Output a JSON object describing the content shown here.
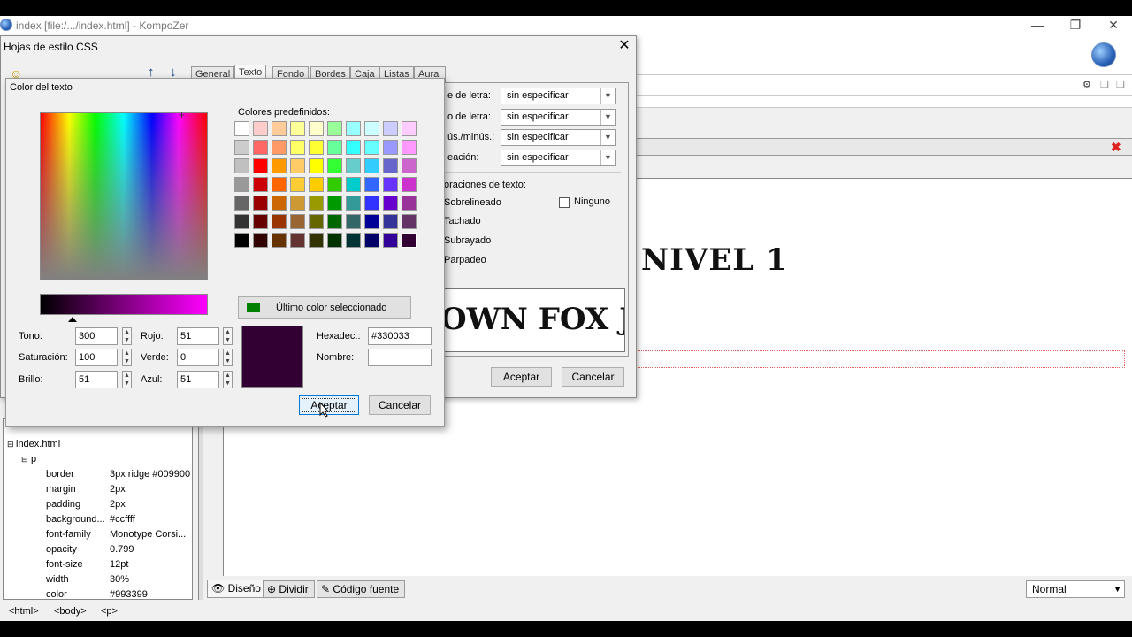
{
  "window": {
    "title": "index [file:/.../index.html] - KompoZer",
    "min": "—",
    "max": "❐",
    "close": "✕"
  },
  "editor": {
    "heading": "NIVEL 1"
  },
  "viewtabs": {
    "design": "Diseño",
    "split": "Dividir",
    "source": "Código fuente",
    "paragraph_format": "Normal"
  },
  "statusbar": {
    "crumbs": [
      "<html>",
      "<body>",
      "<p>"
    ]
  },
  "tree": {
    "root": "index.html",
    "node": "p",
    "props": [
      {
        "name": "border",
        "value": "3px ridge #009900"
      },
      {
        "name": "margin",
        "value": "2px"
      },
      {
        "name": "padding",
        "value": "2px"
      },
      {
        "name": "background...",
        "value": "#ccffff"
      },
      {
        "name": "font-family",
        "value": "Monotype Corsi..."
      },
      {
        "name": "opacity",
        "value": "0.799"
      },
      {
        "name": "font-size",
        "value": "12pt"
      },
      {
        "name": "width",
        "value": "30%"
      },
      {
        "name": "color",
        "value": "#993399"
      }
    ]
  },
  "css_dialog": {
    "title": "Hojas de estilo CSS",
    "close": "✕",
    "tabs": [
      "General",
      "Texto",
      "Fondo",
      "Bordes",
      "Caja",
      "Listas",
      "Aural"
    ],
    "active_tab": "Texto",
    "rows": [
      {
        "label": "e de letra:",
        "value": "sin especificar"
      },
      {
        "label": "o de letra:",
        "value": "sin especificar"
      },
      {
        "label": "ús./minús.:",
        "value": "sin especificar"
      },
      {
        "label": "eación:",
        "value": "sin especificar"
      }
    ],
    "decorations_label": "oraciones de texto:",
    "decorations": [
      "Sobrelineado",
      "Tachado",
      "Subrayado",
      "Parpadeo"
    ],
    "none_label": "Ninguno",
    "preview_text": "OWN FOX JU",
    "accept": "Aceptar",
    "cancel": "Cancelar"
  },
  "color_dialog": {
    "title": "Color del texto",
    "predefined_label": "Colores predefinidos:",
    "swatch_rows": [
      [
        "#ffffff",
        "#ffcccc",
        "#ffcc99",
        "#ffff99",
        "#ffffcc",
        "#99ff99",
        "#99ffff",
        "#ccffff",
        "#ccccff",
        "#ffccff"
      ],
      [
        "#cccccc",
        "#ff6666",
        "#ff9966",
        "#ffff66",
        "#ffff33",
        "#66ff99",
        "#33ffff",
        "#66ffff",
        "#9999ff",
        "#ff99ff"
      ],
      [
        "#c0c0c0",
        "#ff0000",
        "#ff9900",
        "#ffcc66",
        "#ffff00",
        "#33ff33",
        "#66cccc",
        "#33ccff",
        "#6666cc",
        "#cc66cc"
      ],
      [
        "#999999",
        "#cc0000",
        "#ff6600",
        "#ffcc33",
        "#ffcc00",
        "#33cc00",
        "#00cccc",
        "#3366ff",
        "#6633ff",
        "#cc33cc"
      ],
      [
        "#666666",
        "#990000",
        "#cc6600",
        "#cc9933",
        "#999900",
        "#009900",
        "#339999",
        "#3333ff",
        "#6600cc",
        "#993399"
      ],
      [
        "#333333",
        "#660000",
        "#993300",
        "#996633",
        "#666600",
        "#006600",
        "#336666",
        "#000099",
        "#333399",
        "#663366"
      ],
      [
        "#000000",
        "#330000",
        "#663300",
        "#663333",
        "#333300",
        "#003300",
        "#003333",
        "#000066",
        "#330099",
        "#330033"
      ]
    ],
    "last_color_label": "Último color seleccionado",
    "last_color": "#008000",
    "fields": {
      "hue_label": "Tono:",
      "hue": "300",
      "sat_label": "Saturación:",
      "sat": "100",
      "bri_label": "Brillo:",
      "bri": "51",
      "red_label": "Rojo:",
      "red": "51",
      "green_label": "Verde:",
      "green": "0",
      "blue_label": "Azul:",
      "blue": "51",
      "hex_label": "Hexadec.:",
      "hex": "#330033",
      "name_label": "Nombre:",
      "name": ""
    },
    "current_color": "#330033",
    "accept": "Aceptar",
    "cancel": "Cancelar"
  }
}
